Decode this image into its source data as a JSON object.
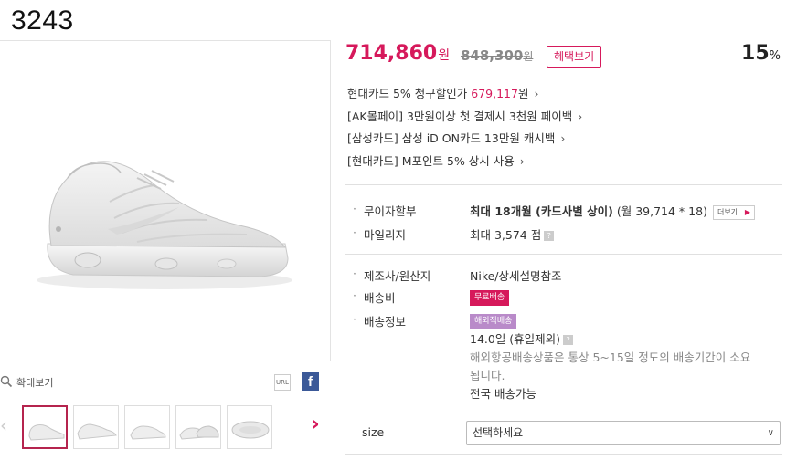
{
  "page": {
    "id_label": "3243"
  },
  "gallery": {
    "zoom_label": "확대보기",
    "url_label": "URL",
    "facebook_label": "f",
    "prev_arrow": "‹",
    "next_arrow": "›",
    "thumbnail_count": 5,
    "active_thumbnail": 1
  },
  "price": {
    "sale_value": "714,860",
    "sale_unit": "원",
    "original_value": "848,300",
    "original_unit": "원",
    "benefit_button": "혜택보기",
    "discount_value": "15",
    "discount_unit": "%"
  },
  "promos": [
    {
      "text": "현대카드 5% 청구할인가 ",
      "highlight": "679,117",
      "suffix": "원",
      "arrow": "›"
    },
    {
      "text": "[AK몰페이] 3만원이상 첫 결제시 3천원 페이백",
      "highlight": "",
      "suffix": "",
      "arrow": "›"
    },
    {
      "text": "[삼성카드] 삼성 iD ON카드 13만원 캐시백",
      "highlight": "",
      "suffix": "",
      "arrow": "›"
    },
    {
      "text": "[현대카드] M포인트 5% 상시 사용",
      "highlight": "",
      "suffix": "",
      "arrow": "›"
    }
  ],
  "installment": {
    "label": "무이자할부",
    "bold_value": "최대 18개월 (카드사별 상이)",
    "detail": "(월 39,714 * 18)",
    "more_button": "더보기"
  },
  "mileage": {
    "label": "마일리지",
    "value": "최대 3,574 점"
  },
  "maker": {
    "label": "제조사/원산지",
    "value": "Nike/상세설명참조"
  },
  "shipping_fee": {
    "label": "배송비",
    "badge": "무료배송"
  },
  "shipping_info": {
    "label": "배송정보",
    "badge": "해외직배송",
    "days": "14.0일 (휴일제외)",
    "note_line1": "해외항공배송상품은 통상 5~15일 정도의 배송기간이 소요",
    "note_line2": "됩니다.",
    "area": "전국 배송가능"
  },
  "size": {
    "label": "size",
    "selected": "선택하세요"
  },
  "colors": {
    "accent": "#d6195b",
    "overseas_badge": "#b98ac9",
    "facebook": "#3b5998"
  }
}
